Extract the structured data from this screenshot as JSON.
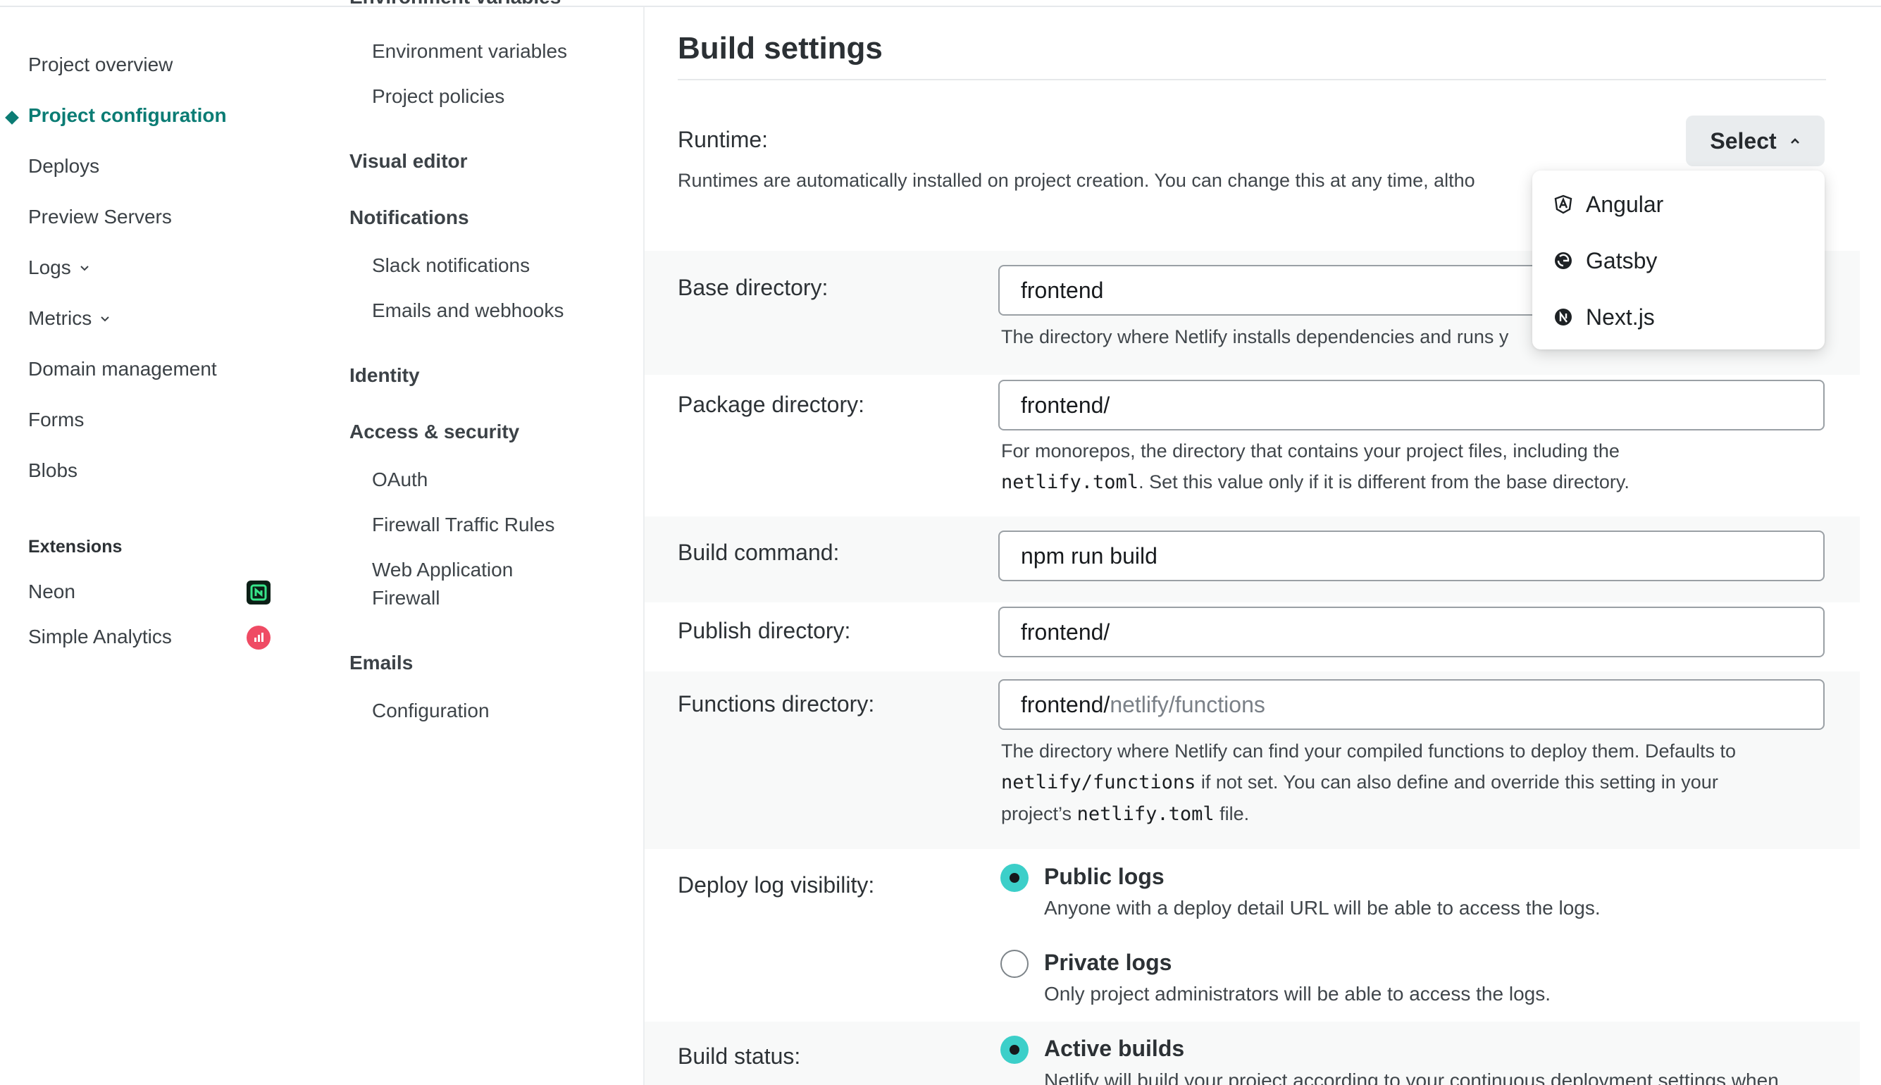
{
  "primary_nav": {
    "items": [
      {
        "label": "Project overview"
      },
      {
        "label": "Project configuration"
      },
      {
        "label": "Deploys"
      },
      {
        "label": "Preview Servers"
      },
      {
        "label": "Logs"
      },
      {
        "label": "Metrics"
      },
      {
        "label": "Domain management"
      },
      {
        "label": "Forms"
      },
      {
        "label": "Blobs"
      }
    ],
    "active": "Project configuration",
    "extensions_heading": "Extensions",
    "extensions": [
      {
        "label": "Neon",
        "icon": "neon-logo-icon",
        "color": "#0b1f16"
      },
      {
        "label": "Simple Analytics",
        "icon": "simple-analytics-icon",
        "color": "#ef4b64"
      }
    ]
  },
  "secondary_nav": {
    "cut_off_heading": "Environment variables",
    "env_items": [
      "Environment variables",
      "Project policies"
    ],
    "visual_editor": "Visual editor",
    "notifications": "Notifications",
    "notification_items": [
      "Slack notifications",
      "Emails and webhooks"
    ],
    "identity": "Identity",
    "access_security": "Access & security",
    "access_items": [
      "OAuth",
      "Firewall Traffic Rules",
      "Web Application Firewall"
    ],
    "emails": "Emails",
    "email_items": [
      "Configuration"
    ]
  },
  "main": {
    "title": "Build settings",
    "runtime": {
      "label": "Runtime:",
      "description": "Runtimes are automatically installed on project creation. You can change this at any time, altho",
      "select_label": "Select",
      "options": [
        {
          "label": "Angular",
          "icon": "angular-icon"
        },
        {
          "label": "Gatsby",
          "icon": "gatsby-icon"
        },
        {
          "label": "Next.js",
          "icon": "nextjs-icon"
        }
      ]
    },
    "base_directory": {
      "label": "Base directory:",
      "value": "frontend",
      "help": "The directory where Netlify installs dependencies and runs y"
    },
    "package_directory": {
      "label": "Package directory:",
      "value": "frontend/",
      "help_pre": "For monorepos, the directory that contains your project files, including the",
      "help_code": "netlify.toml",
      "help_post": ". Set this value only if it is different from the base directory."
    },
    "build_command": {
      "label": "Build command:",
      "value": "npm run build"
    },
    "publish_directory": {
      "label": "Publish directory:",
      "value": "frontend/"
    },
    "functions_directory": {
      "label": "Functions directory:",
      "value": "frontend/",
      "placeholder_suffix": "netlify/functions",
      "help_1": "The directory where Netlify can find your compiled functions to deploy them. Defaults to",
      "help_code_1": "netlify/functions",
      "help_2": " if not set. You can also define and override this setting in your",
      "help_3": "project’s ",
      "help_code_2": "netlify.toml",
      "help_4": " file."
    },
    "deploy_log_visibility": {
      "label": "Deploy log visibility:",
      "options": [
        {
          "title": "Public logs",
          "description": "Anyone with a deploy detail URL will be able to access the logs.",
          "selected": true
        },
        {
          "title": "Private logs",
          "description": "Only project administrators will be able to access the logs.",
          "selected": false
        }
      ]
    },
    "build_status": {
      "label": "Build status:",
      "option_title": "Active builds",
      "option_description_cut": "Netlify will build your project according to your continuous deployment settings when"
    }
  },
  "colors": {
    "accent": "#0b7c74",
    "radio_selected": "#3ccfc9"
  }
}
